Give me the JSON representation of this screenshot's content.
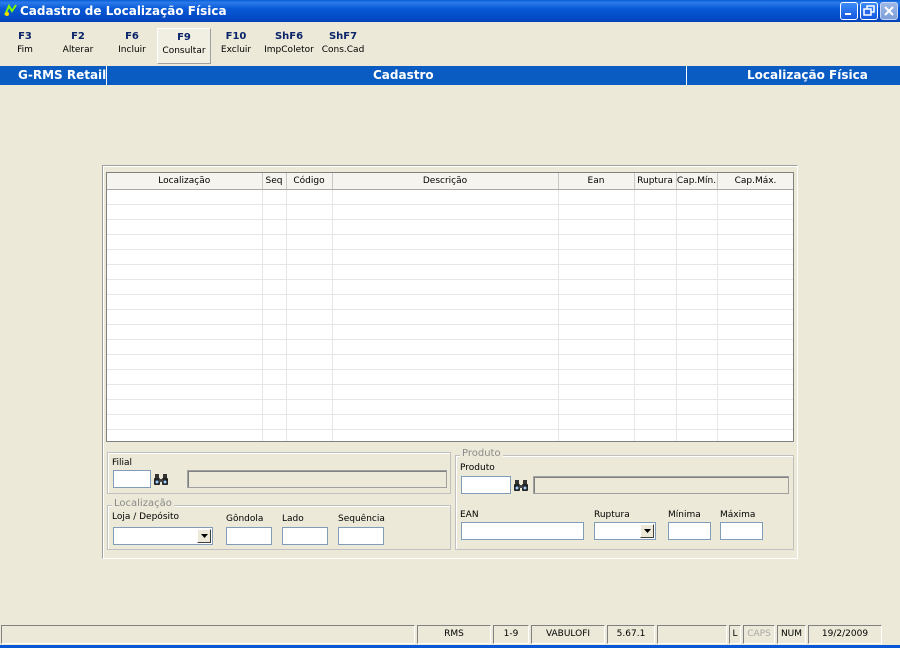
{
  "window": {
    "title": "Cadastro de Localização Física"
  },
  "toolbar": {
    "keys": [
      {
        "key": "F3",
        "label": "Fim"
      },
      {
        "key": "F2",
        "label": "Alterar"
      },
      {
        "key": "F6",
        "label": "Incluir"
      },
      {
        "key": "F9",
        "label": "Consultar"
      },
      {
        "key": "F10",
        "label": "Excluir"
      },
      {
        "key": "ShF6",
        "label": "ImpColetor"
      },
      {
        "key": "ShF7",
        "label": "Cons.Cad"
      }
    ]
  },
  "header": {
    "left": "G-RMS Retail",
    "center": "Cadastro",
    "right": "Localização Física"
  },
  "grid": {
    "columns": [
      "Localização",
      "Seq",
      "Código",
      "Descrição",
      "Ean",
      "Ruptura",
      "Cap.Mín.",
      "Cap.Máx."
    ]
  },
  "filial": {
    "label": "Filial"
  },
  "localizacao": {
    "legend": "Localização",
    "loja_label": "Loja / Depósito",
    "gondola_label": "Gôndola",
    "lado_label": "Lado",
    "sequencia_label": "Sequência"
  },
  "produto": {
    "legend": "Produto",
    "produto_label": "Produto",
    "ean_label": "EAN",
    "ruptura_label": "Ruptura",
    "minima_label": "Mínima",
    "maxima_label": "Máxima"
  },
  "statusbar": {
    "system": "RMS",
    "range": "1-9",
    "user": "VABULOFI",
    "version": "5.67.1",
    "l": "L",
    "caps": "CAPS",
    "num": "NUM",
    "date": "19/2/2009"
  }
}
